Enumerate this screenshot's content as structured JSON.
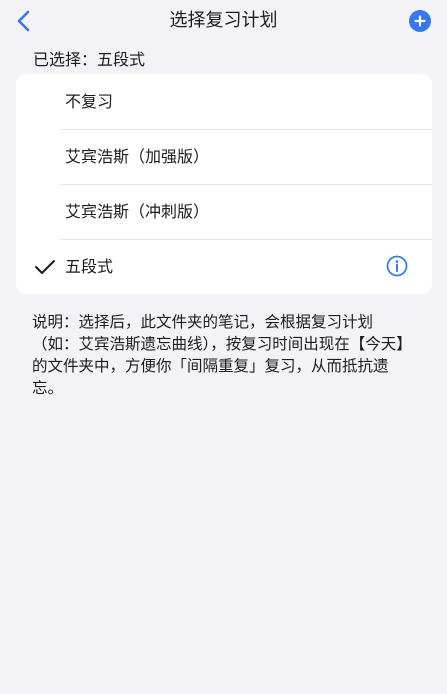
{
  "nav": {
    "title": "选择复习计划"
  },
  "selected_label": "已选择：五段式",
  "options": [
    {
      "label": "不复习",
      "checked": false
    },
    {
      "label": "艾宾浩斯（加强版）",
      "checked": false
    },
    {
      "label": "艾宾浩斯（冲刺版）",
      "checked": false
    },
    {
      "label": "五段式",
      "checked": true
    }
  ],
  "description": "说明：选择后，此文件夹的笔记，会根据复习计划（如：艾宾浩斯遗忘曲线），按复习时间出现在【今天】的文件夹中，方便你「间隔重复」复习，从而抵抗遗忘。",
  "icons": {
    "back": "chevron-left-icon",
    "add": "plus-circle-icon",
    "check": "checkmark-icon",
    "info": "info-circle-icon"
  },
  "colors": {
    "accent": "#3478f6",
    "background": "#f2f2f7",
    "card": "#ffffff",
    "separator": "#e5e5ea"
  }
}
